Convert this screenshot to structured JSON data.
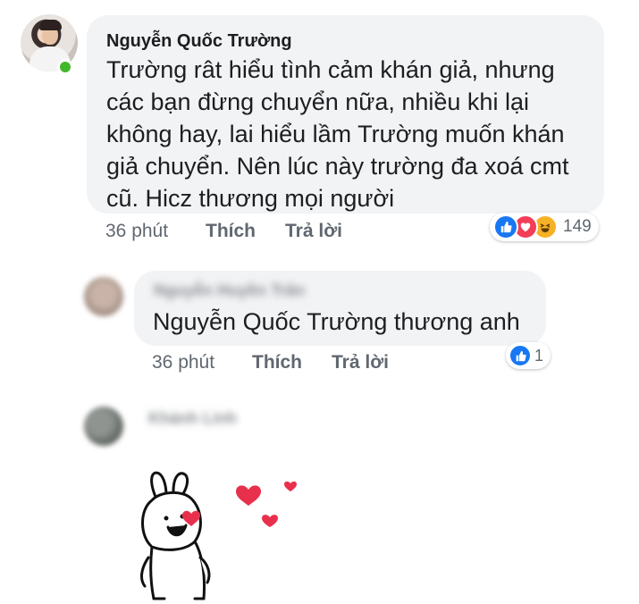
{
  "comments": [
    {
      "author": "Nguyễn Quốc Trường",
      "text": "Trường rât hiểu tình cảm khán giả, nhưng các bạn đừng chuyển nữa, nhiều khi lại không hay, lai hiểu lầm Trường muốn khán giả chuyển. Nên lúc này trường đa xoá cmt cũ. Hicz thương mọi người",
      "time": "36 phút",
      "like_label": "Thích",
      "reply_label": "Trả lời",
      "reaction_icons": [
        "like-icon",
        "love-icon",
        "haha-icon"
      ],
      "reaction_count": "149",
      "online": true
    },
    {
      "author": "Nguyễn Huyền Trân",
      "author_obscured": true,
      "text": "Nguyễn Quốc Trường thương anh",
      "time": "36 phút",
      "like_label": "Thích",
      "reply_label": "Trả lời",
      "reaction_icons": [
        "like-icon"
      ],
      "reaction_count": "1"
    },
    {
      "author": "Khánh Linh",
      "author_obscured": true,
      "sticker": "bunny-hearts-sticker"
    }
  ],
  "colors": {
    "bubble": "#f2f3f5",
    "meta_text": "#606770",
    "like_blue": "#1877f2",
    "love_red": "#f33e58",
    "haha_yellow": "#f7b125",
    "online_green": "#42b72a"
  }
}
